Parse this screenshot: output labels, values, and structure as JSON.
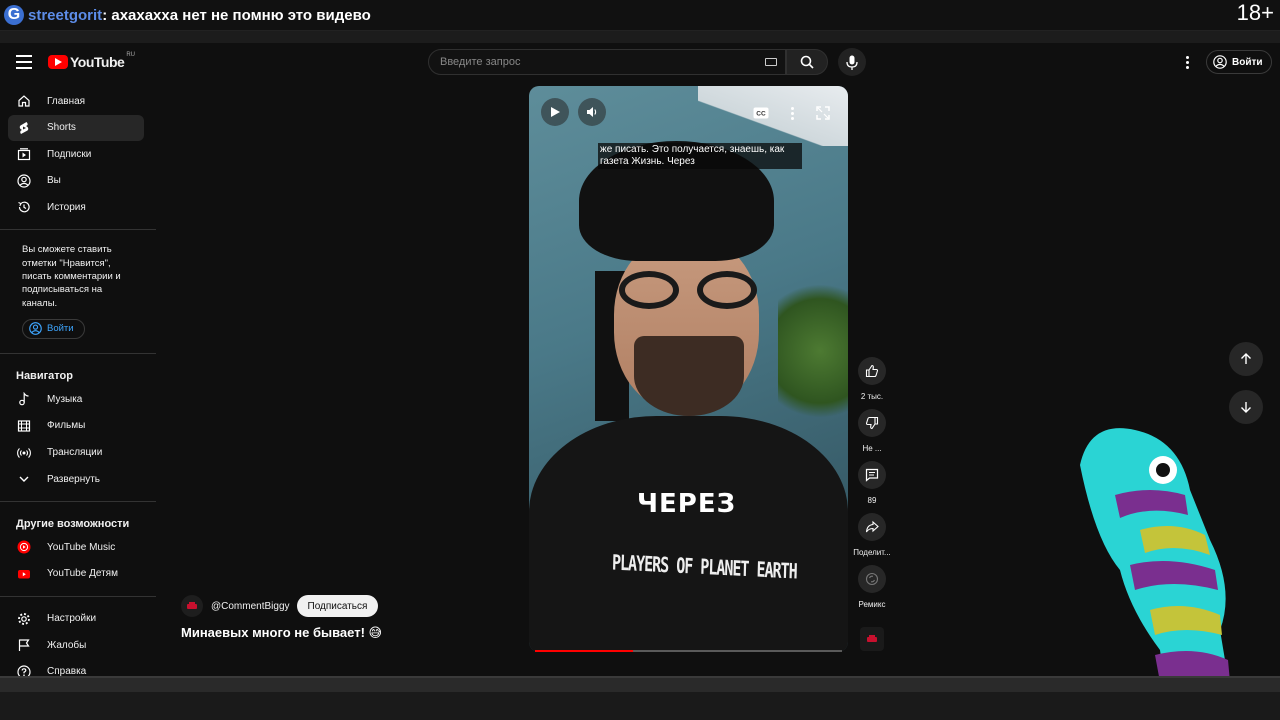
{
  "overlay": {
    "chat_logo": "G",
    "chat_user": "streetgorit",
    "chat_message": ": ахахахха нет не помню это видево",
    "age_rating": "18+"
  },
  "header": {
    "logo_text": "YouTube",
    "logo_region": "RU",
    "search_placeholder": "Введите запрос",
    "signin_label": "Войти"
  },
  "sidebar": {
    "main_items": [
      {
        "label": "Главная",
        "icon": "home-icon"
      },
      {
        "label": "Shorts",
        "icon": "shorts-icon",
        "active": true
      },
      {
        "label": "Подписки",
        "icon": "subscriptions-icon"
      },
      {
        "label": "Вы",
        "icon": "user-icon"
      },
      {
        "label": "История",
        "icon": "history-icon"
      }
    ],
    "promo_text": "Вы сможете ставить отметки \"Нравится\", писать комментарии и подписываться на каналы.",
    "promo_signin": "Войти",
    "navigator_title": "Навигатор",
    "navigator_items": [
      {
        "label": "Музыка",
        "icon": "music-icon"
      },
      {
        "label": "Фильмы",
        "icon": "film-icon"
      },
      {
        "label": "Трансляции",
        "icon": "live-icon"
      },
      {
        "label": "Развернуть",
        "icon": "chevron-down-icon"
      }
    ],
    "other_title": "Другие возможности",
    "other_items": [
      {
        "label": "YouTube Music",
        "icon": "youtube-music-icon"
      },
      {
        "label": "YouTube Детям",
        "icon": "youtube-kids-icon"
      }
    ],
    "footer_items": [
      {
        "label": "Настройки",
        "icon": "settings-icon"
      },
      {
        "label": "Жалобы",
        "icon": "flag-icon"
      },
      {
        "label": "Справка",
        "icon": "help-icon"
      }
    ]
  },
  "video": {
    "caption": "же писать. Это получается, знаешь, как газета Жизнь. Через",
    "overlay_word": "ЧЕРЕЗ",
    "shirt_text": "PLAYERS OF PLANET EARTH",
    "progress": 0.32
  },
  "actions": {
    "likes": "2 тыс.",
    "dislike": "Не ...",
    "comments": "89",
    "share": "Поделит...",
    "remix": "Ремикс"
  },
  "channel": {
    "handle": "@CommentBiggy",
    "subscribe_label": "Подписаться",
    "video_title": "Минаевых много не бывает! 😅"
  }
}
